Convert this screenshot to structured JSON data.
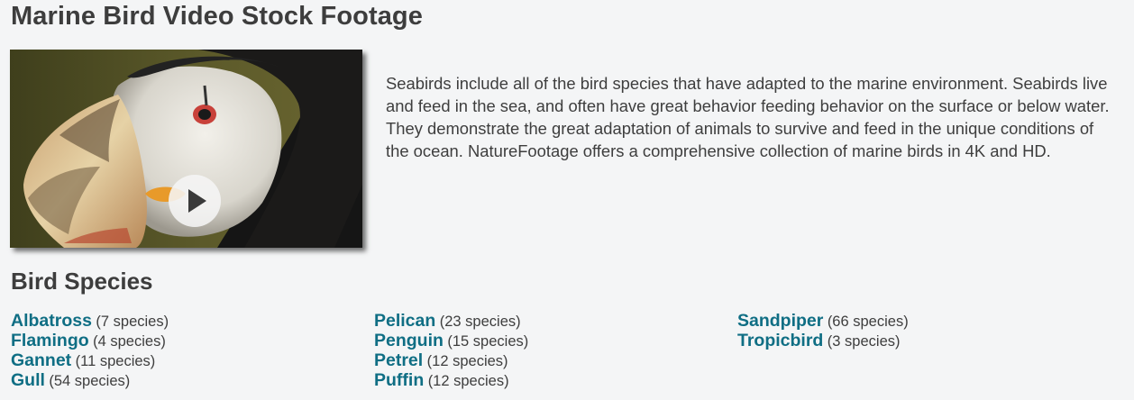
{
  "page": {
    "title": "Marine Bird Video Stock Footage",
    "description": "Seabirds include all of the bird species that have adapted to the marine environment. Seabirds live and feed in the sea, and often have great behavior feeding behavior on the surface or below water. They demonstrate the great adaptation of animals to survive and feed in the unique conditions of the ocean. NatureFootage offers a comprehensive collection of marine birds in 4K and HD."
  },
  "video": {
    "subject": "puffin",
    "play_icon": "play-icon"
  },
  "species_section": {
    "title": "Bird Species",
    "columns": [
      [
        {
          "name": "Albatross",
          "count": "(7 species)"
        },
        {
          "name": "Flamingo",
          "count": "(4 species)"
        },
        {
          "name": "Gannet",
          "count": "(11 species)"
        },
        {
          "name": "Gull",
          "count": "(54 species)"
        }
      ],
      [
        {
          "name": "Pelican",
          "count": "(23 species)"
        },
        {
          "name": "Penguin",
          "count": "(15 species)"
        },
        {
          "name": "Petrel",
          "count": "(12 species)"
        },
        {
          "name": "Puffin",
          "count": "(12 species)"
        }
      ],
      [
        {
          "name": "Sandpiper",
          "count": "(66 species)"
        },
        {
          "name": "Tropicbird",
          "count": "(3 species)"
        }
      ]
    ]
  },
  "colors": {
    "link": "#0f6e84",
    "text": "#3e3e3e",
    "background": "#f4f5f6"
  }
}
